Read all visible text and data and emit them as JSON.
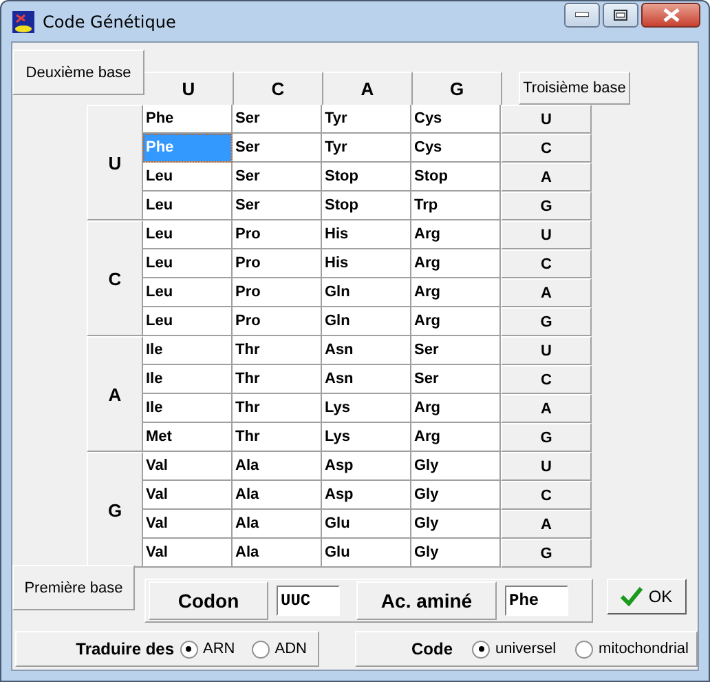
{
  "window": {
    "title": "Code Génétique"
  },
  "second_base": {
    "label": "Deuxième base",
    "bases": [
      "U",
      "C",
      "A",
      "G"
    ]
  },
  "third_base": {
    "label": "Troisième base"
  },
  "groups": [
    {
      "base": "U",
      "rows": [
        {
          "cells": [
            {
              "text": "Phe",
              "selected": false
            },
            {
              "text": "Ser",
              "selected": false
            },
            {
              "text": "Tyr",
              "selected": false
            },
            {
              "text": "Cys",
              "selected": false
            }
          ],
          "third": "U"
        },
        {
          "cells": [
            {
              "text": "Phe",
              "selected": true
            },
            {
              "text": "Ser",
              "selected": false
            },
            {
              "text": "Tyr",
              "selected": false
            },
            {
              "text": "Cys",
              "selected": false
            }
          ],
          "third": "C"
        },
        {
          "cells": [
            {
              "text": "Leu",
              "selected": false
            },
            {
              "text": "Ser",
              "selected": false
            },
            {
              "text": "Stop",
              "selected": false
            },
            {
              "text": "Stop",
              "selected": false
            }
          ],
          "third": "A"
        },
        {
          "cells": [
            {
              "text": "Leu",
              "selected": false
            },
            {
              "text": "Ser",
              "selected": false
            },
            {
              "text": "Stop",
              "selected": false
            },
            {
              "text": "Trp",
              "selected": false
            }
          ],
          "third": "G"
        }
      ]
    },
    {
      "base": "C",
      "rows": [
        {
          "cells": [
            {
              "text": "Leu",
              "selected": false
            },
            {
              "text": "Pro",
              "selected": false
            },
            {
              "text": "His",
              "selected": false
            },
            {
              "text": "Arg",
              "selected": false
            }
          ],
          "third": "U"
        },
        {
          "cells": [
            {
              "text": "Leu",
              "selected": false
            },
            {
              "text": "Pro",
              "selected": false
            },
            {
              "text": "His",
              "selected": false
            },
            {
              "text": "Arg",
              "selected": false
            }
          ],
          "third": "C"
        },
        {
          "cells": [
            {
              "text": "Leu",
              "selected": false
            },
            {
              "text": "Pro",
              "selected": false
            },
            {
              "text": "Gln",
              "selected": false
            },
            {
              "text": "Arg",
              "selected": false
            }
          ],
          "third": "A"
        },
        {
          "cells": [
            {
              "text": "Leu",
              "selected": false
            },
            {
              "text": "Pro",
              "selected": false
            },
            {
              "text": "Gln",
              "selected": false
            },
            {
              "text": "Arg",
              "selected": false
            }
          ],
          "third": "G"
        }
      ]
    },
    {
      "base": "A",
      "rows": [
        {
          "cells": [
            {
              "text": "Ile",
              "selected": false
            },
            {
              "text": "Thr",
              "selected": false
            },
            {
              "text": "Asn",
              "selected": false
            },
            {
              "text": "Ser",
              "selected": false
            }
          ],
          "third": "U"
        },
        {
          "cells": [
            {
              "text": "Ile",
              "selected": false
            },
            {
              "text": "Thr",
              "selected": false
            },
            {
              "text": "Asn",
              "selected": false
            },
            {
              "text": "Ser",
              "selected": false
            }
          ],
          "third": "C"
        },
        {
          "cells": [
            {
              "text": "Ile",
              "selected": false
            },
            {
              "text": "Thr",
              "selected": false
            },
            {
              "text": "Lys",
              "selected": false
            },
            {
              "text": "Arg",
              "selected": false
            }
          ],
          "third": "A"
        },
        {
          "cells": [
            {
              "text": "Met",
              "selected": false
            },
            {
              "text": "Thr",
              "selected": false
            },
            {
              "text": "Lys",
              "selected": false
            },
            {
              "text": "Arg",
              "selected": false
            }
          ],
          "third": "G"
        }
      ]
    },
    {
      "base": "G",
      "rows": [
        {
          "cells": [
            {
              "text": "Val",
              "selected": false
            },
            {
              "text": "Ala",
              "selected": false
            },
            {
              "text": "Asp",
              "selected": false
            },
            {
              "text": "Gly",
              "selected": false
            }
          ],
          "third": "U"
        },
        {
          "cells": [
            {
              "text": "Val",
              "selected": false
            },
            {
              "text": "Ala",
              "selected": false
            },
            {
              "text": "Asp",
              "selected": false
            },
            {
              "text": "Gly",
              "selected": false
            }
          ],
          "third": "C"
        },
        {
          "cells": [
            {
              "text": "Val",
              "selected": false
            },
            {
              "text": "Ala",
              "selected": false
            },
            {
              "text": "Glu",
              "selected": false
            },
            {
              "text": "Gly",
              "selected": false
            }
          ],
          "third": "A"
        },
        {
          "cells": [
            {
              "text": "Val",
              "selected": false
            },
            {
              "text": "Ala",
              "selected": false
            },
            {
              "text": "Glu",
              "selected": false
            },
            {
              "text": "Gly",
              "selected": false
            }
          ],
          "third": "G"
        }
      ]
    }
  ],
  "first_base": {
    "label": "Première base"
  },
  "codon": {
    "label": "Codon",
    "value": "UUC"
  },
  "amino_acid": {
    "label": "Ac. aminé",
    "value": "Phe"
  },
  "ok_button": "OK",
  "translate": {
    "label": "Traduire des",
    "options": [
      {
        "label": "ARN",
        "selected": true
      },
      {
        "label": "ADN",
        "selected": false
      }
    ]
  },
  "code": {
    "label": "Code",
    "options": [
      {
        "label": "universel",
        "selected": true
      },
      {
        "label": "mitochondrial",
        "selected": false
      }
    ]
  }
}
